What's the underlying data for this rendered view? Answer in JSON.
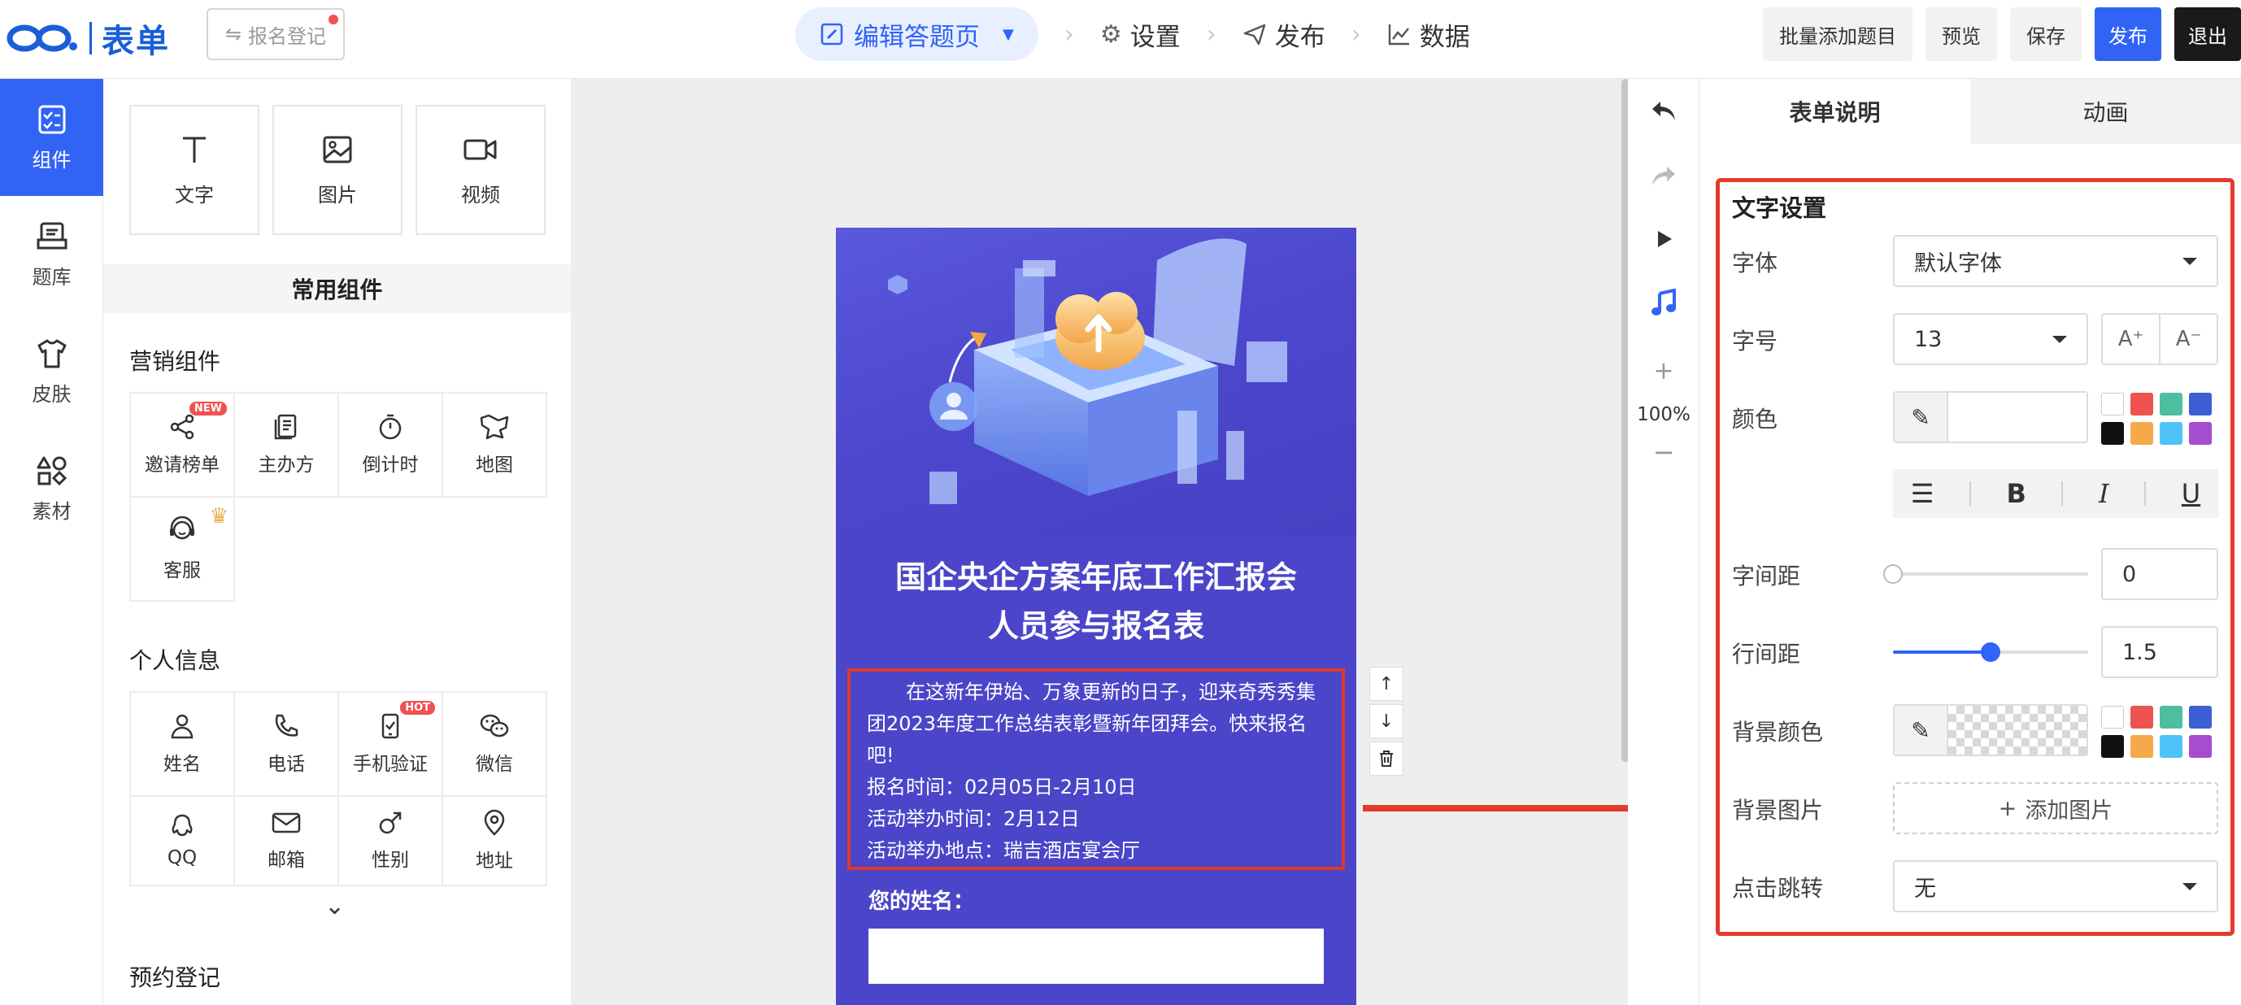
{
  "header": {
    "logo_text": "表单",
    "form_name": "报名登记",
    "steps": [
      "编辑答题页",
      "设置",
      "发布",
      "数据"
    ],
    "actions": {
      "batch_add": "批量添加题目",
      "preview": "预览",
      "save": "保存",
      "publish": "发布",
      "exit": "退出"
    }
  },
  "leftnav": {
    "items": [
      {
        "label": "组件",
        "icon": "component-icon",
        "active": true
      },
      {
        "label": "题库",
        "icon": "question-bank-icon",
        "active": false
      },
      {
        "label": "皮肤",
        "icon": "skin-icon",
        "active": false
      },
      {
        "label": "素材",
        "icon": "material-icon",
        "active": false
      }
    ]
  },
  "components": {
    "basic": [
      {
        "label": "文字",
        "icon": "text-icon"
      },
      {
        "label": "图片",
        "icon": "image-icon"
      },
      {
        "label": "视频",
        "icon": "video-icon"
      }
    ],
    "common_title": "常用组件",
    "marketing": {
      "title": "营销组件",
      "items": [
        {
          "label": "邀请榜单",
          "icon": "share-icon",
          "badge": "NEW"
        },
        {
          "label": "主办方",
          "icon": "organizer-icon"
        },
        {
          "label": "倒计时",
          "icon": "stopwatch-icon"
        },
        {
          "label": "地图",
          "icon": "map-icon"
        },
        {
          "label": "客服",
          "icon": "support-icon",
          "crown": true
        }
      ]
    },
    "personal": {
      "title": "个人信息",
      "items": [
        {
          "label": "姓名",
          "icon": "person-icon"
        },
        {
          "label": "电话",
          "icon": "phone-icon"
        },
        {
          "label": "手机验证",
          "icon": "mobile-verify-icon",
          "badge": "HOT"
        },
        {
          "label": "微信",
          "icon": "wechat-icon"
        },
        {
          "label": "QQ",
          "icon": "qq-icon"
        },
        {
          "label": "邮箱",
          "icon": "mail-icon"
        },
        {
          "label": "性别",
          "icon": "gender-icon"
        },
        {
          "label": "地址",
          "icon": "location-icon"
        }
      ]
    },
    "appointment_title": "预约登记"
  },
  "canvas": {
    "title_line1": "国企央企方案年底工作汇报会",
    "title_line2": "人员参与报名表",
    "description": [
      "在这新年伊始、万象更新的日子，迎来奇秀秀集团2023年度工作总结表彰暨新年团拜会。快来报名吧!",
      "报名时间：02月05日-2月10日",
      "活动举办时间：2月12日",
      "活动举办地点：瑞吉酒店宴会厅"
    ],
    "name_label": "您的姓名：",
    "name_placeholder": ""
  },
  "toolcol": {
    "zoom": "100%"
  },
  "rpanel": {
    "tabs": [
      "表单说明",
      "动画"
    ],
    "section_title": "文字设置",
    "font_label": "字体",
    "font_value": "默认字体",
    "size_label": "字号",
    "size_value": "13",
    "size_up": "A⁺",
    "size_down": "A⁻",
    "color_label": "颜色",
    "letter_spacing_label": "字间距",
    "letter_spacing_value": "0",
    "letter_spacing_level": 0,
    "line_height_label": "行间距",
    "line_height_value": "1.5",
    "line_height_level": 0.5,
    "bg_color_label": "背景颜色",
    "bg_image_label": "背景图片",
    "add_image": "添加图片",
    "click_jump_label": "点击跳转",
    "click_jump_value": "无",
    "swatches": [
      "#ffffff",
      "#ef5350",
      "#4dbfa0",
      "#3b5fd4",
      "#111111",
      "#f5a94a",
      "#4fc3f7",
      "#a64ccf"
    ]
  },
  "colors": {
    "accent": "#3163f5",
    "highlight_red": "#e53a2a",
    "phone_bg": "#4b45c9"
  }
}
